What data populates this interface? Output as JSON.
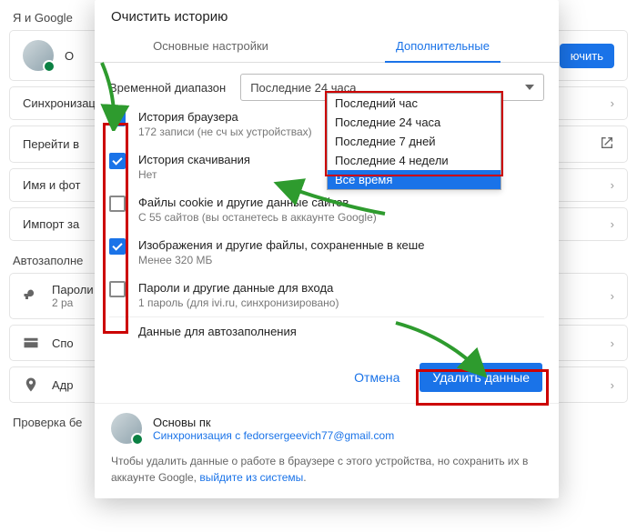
{
  "bg": {
    "header": "Я и Google",
    "rows": {
      "sync": "Синхронизация",
      "goto": "Перейти в",
      "name": "Имя и фот",
      "import": "Импорт за",
      "password": "Пароли",
      "password_sub": "2 ра",
      "payments": "Спо",
      "addresses": "Адр"
    },
    "section_autofill": "Автозаполне",
    "section_check": "Проверка бе",
    "turn_on": "ючить"
  },
  "dialog": {
    "title": "Очистить историю",
    "tabs": {
      "basic": "Основные настройки",
      "advanced": "Дополнительные"
    },
    "timerange_label": "Временной диапазон",
    "selected_range": "Последние 24 часа",
    "dropdown": [
      "Последний час",
      "Последние 24 часа",
      "Последние 7 дней",
      "Последние 4 недели",
      "Все время"
    ],
    "items": [
      {
        "title": "История браузера",
        "sub": "172 записи (не сч                                               ых устройствах)",
        "checked": true
      },
      {
        "title": "История скачивания",
        "sub": "Нет",
        "checked": true
      },
      {
        "title": "Файлы cookie и другие данные сайтов",
        "sub": "С 55 сайтов (вы останетесь в аккаунте Google)",
        "checked": false
      },
      {
        "title": "Изображения и другие файлы, сохраненные в кеше",
        "sub": "Менее 320 МБ",
        "checked": true
      },
      {
        "title": "Пароли и другие данные для входа",
        "sub": "1 пароль (для ivi.ru, синхронизировано)",
        "checked": false
      },
      {
        "title": "Данные для автозаполнения",
        "sub": "",
        "checked": false
      }
    ],
    "cancel": "Отмена",
    "delete": "Удалить данные",
    "footer": {
      "name": "Основы пк",
      "sync": "Синхронизация с fedorsergeevich77@gmail.com",
      "note_a": "Чтобы удалить данные о работе в браузере с этого устройства, но сохранить их в аккаунте Google, ",
      "note_link": "выйдите из системы",
      "note_b": "."
    }
  }
}
